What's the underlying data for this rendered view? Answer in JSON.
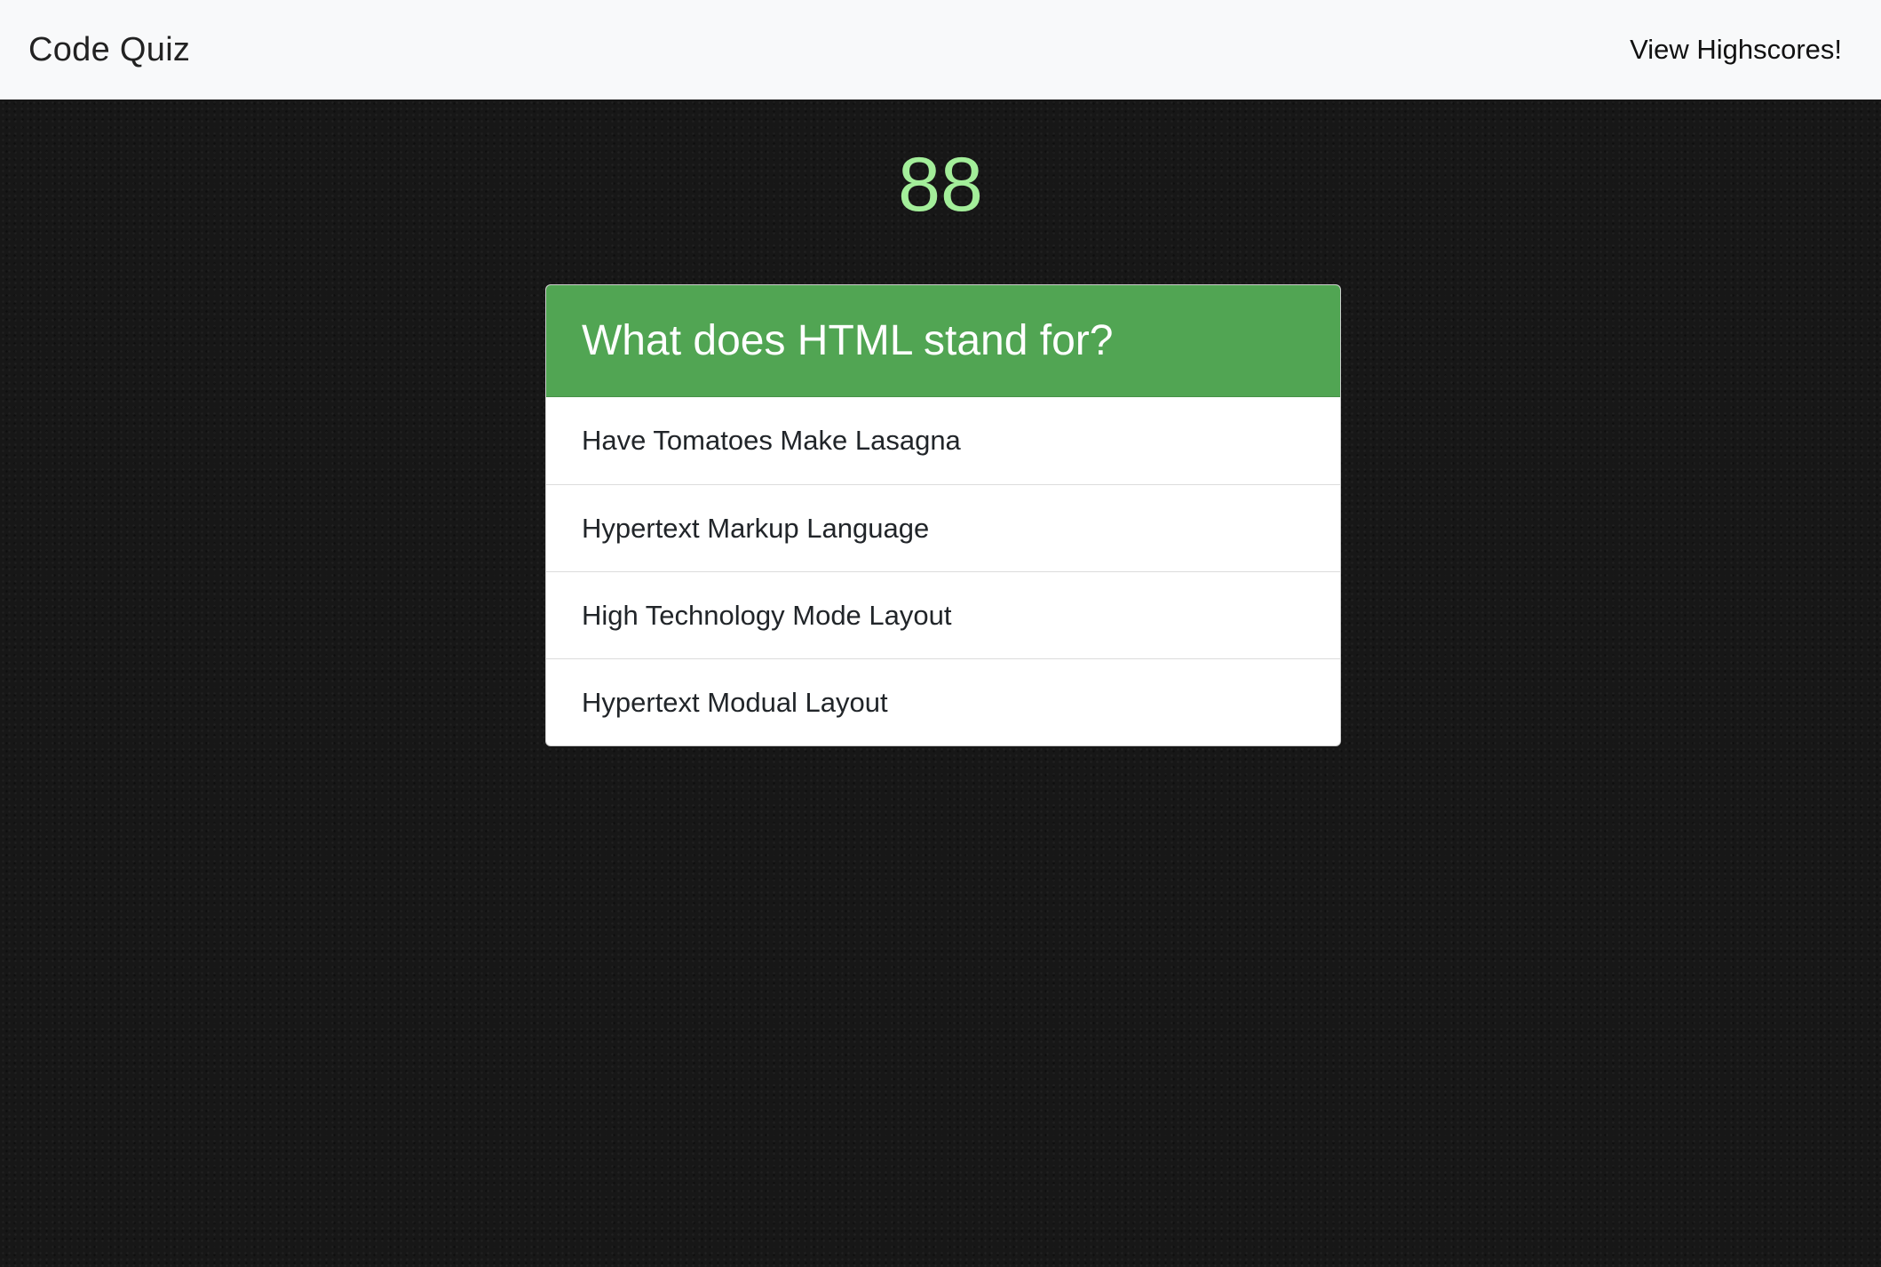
{
  "navbar": {
    "brand": "Code Quiz",
    "highscores_link": "View Highscores!"
  },
  "timer": {
    "value": "88"
  },
  "quiz": {
    "question": "What does HTML stand for?",
    "options": [
      "Have Tomatoes Make Lasagna",
      "Hypertext Markup Language",
      "High Technology Mode Layout",
      "Hypertext Modual Layout"
    ]
  },
  "colors": {
    "navbar_bg": "#f8f9fa",
    "page_bg": "#171717",
    "timer": "#a3ee9a",
    "question_header": "#51a553",
    "card_bg": "#ffffff"
  }
}
